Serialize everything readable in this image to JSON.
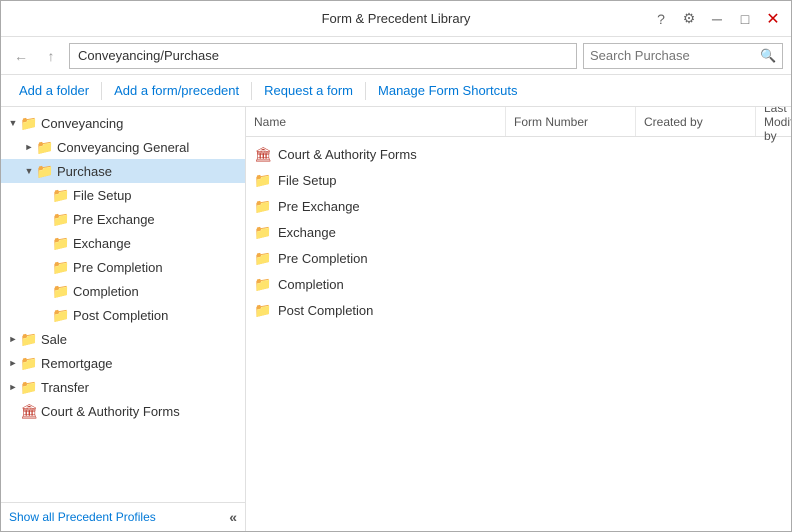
{
  "window": {
    "title": "Form & Precedent Library",
    "controls": {
      "help": "?",
      "settings": "⚙",
      "minimize": "─",
      "maximize": "□",
      "close": "✕"
    }
  },
  "addressBar": {
    "back_tooltip": "Back",
    "up_tooltip": "Up",
    "path": "Conveyancing/Purchase",
    "search_placeholder": "Search Purchase",
    "search_icon": "🔍"
  },
  "toolbar": {
    "add_folder": "Add a folder",
    "add_form": "Add a form/precedent",
    "request_form": "Request a form",
    "manage_shortcuts": "Manage Form Shortcuts"
  },
  "tree": {
    "items": [
      {
        "id": "conveyancing",
        "label": "Conveyancing",
        "indent": 1,
        "expanded": true,
        "has_children": true,
        "icon": "folder",
        "selected": false
      },
      {
        "id": "conveyancing-general",
        "label": "Conveyancing General",
        "indent": 2,
        "expanded": false,
        "has_children": true,
        "icon": "folder",
        "selected": false
      },
      {
        "id": "purchase",
        "label": "Purchase",
        "indent": 2,
        "expanded": true,
        "has_children": true,
        "icon": "folder",
        "selected": true
      },
      {
        "id": "file-setup",
        "label": "File Setup",
        "indent": 3,
        "expanded": false,
        "has_children": false,
        "icon": "folder",
        "selected": false
      },
      {
        "id": "pre-exchange",
        "label": "Pre Exchange",
        "indent": 3,
        "expanded": false,
        "has_children": false,
        "icon": "folder",
        "selected": false
      },
      {
        "id": "exchange",
        "label": "Exchange",
        "indent": 3,
        "expanded": false,
        "has_children": false,
        "icon": "folder",
        "selected": false
      },
      {
        "id": "pre-completion",
        "label": "Pre Completion",
        "indent": 3,
        "expanded": false,
        "has_children": false,
        "icon": "folder",
        "selected": false
      },
      {
        "id": "completion",
        "label": "Completion",
        "indent": 3,
        "expanded": false,
        "has_children": false,
        "icon": "folder",
        "selected": false
      },
      {
        "id": "post-completion",
        "label": "Post Completion",
        "indent": 3,
        "expanded": false,
        "has_children": false,
        "icon": "folder",
        "selected": false
      },
      {
        "id": "sale",
        "label": "Sale",
        "indent": 1,
        "expanded": false,
        "has_children": true,
        "icon": "folder",
        "selected": false
      },
      {
        "id": "remortgage",
        "label": "Remortgage",
        "indent": 1,
        "expanded": false,
        "has_children": true,
        "icon": "folder",
        "selected": false
      },
      {
        "id": "transfer",
        "label": "Transfer",
        "indent": 1,
        "expanded": false,
        "has_children": true,
        "icon": "folder",
        "selected": false
      },
      {
        "id": "court-authority",
        "label": "Court & Authority Forms",
        "indent": 1,
        "expanded": false,
        "has_children": false,
        "icon": "bank",
        "selected": false
      }
    ],
    "show_profiles": "Show all Precedent Profiles",
    "collapse_icon": "«"
  },
  "listHeader": {
    "name": "Name",
    "form_number": "Form Number",
    "created_by": "Created by",
    "last_modified_by": "Last Modified by"
  },
  "listItems": [
    {
      "id": "court",
      "label": "Court & Authority Forms",
      "icon": "bank"
    },
    {
      "id": "file-setup",
      "label": "File Setup",
      "icon": "folder"
    },
    {
      "id": "pre-exchange",
      "label": "Pre Exchange",
      "icon": "folder"
    },
    {
      "id": "exchange",
      "label": "Exchange",
      "icon": "folder"
    },
    {
      "id": "pre-completion",
      "label": "Pre Completion",
      "icon": "folder"
    },
    {
      "id": "completion",
      "label": "Completion",
      "icon": "folder"
    },
    {
      "id": "post-completion",
      "label": "Post Completion",
      "icon": "folder"
    }
  ]
}
